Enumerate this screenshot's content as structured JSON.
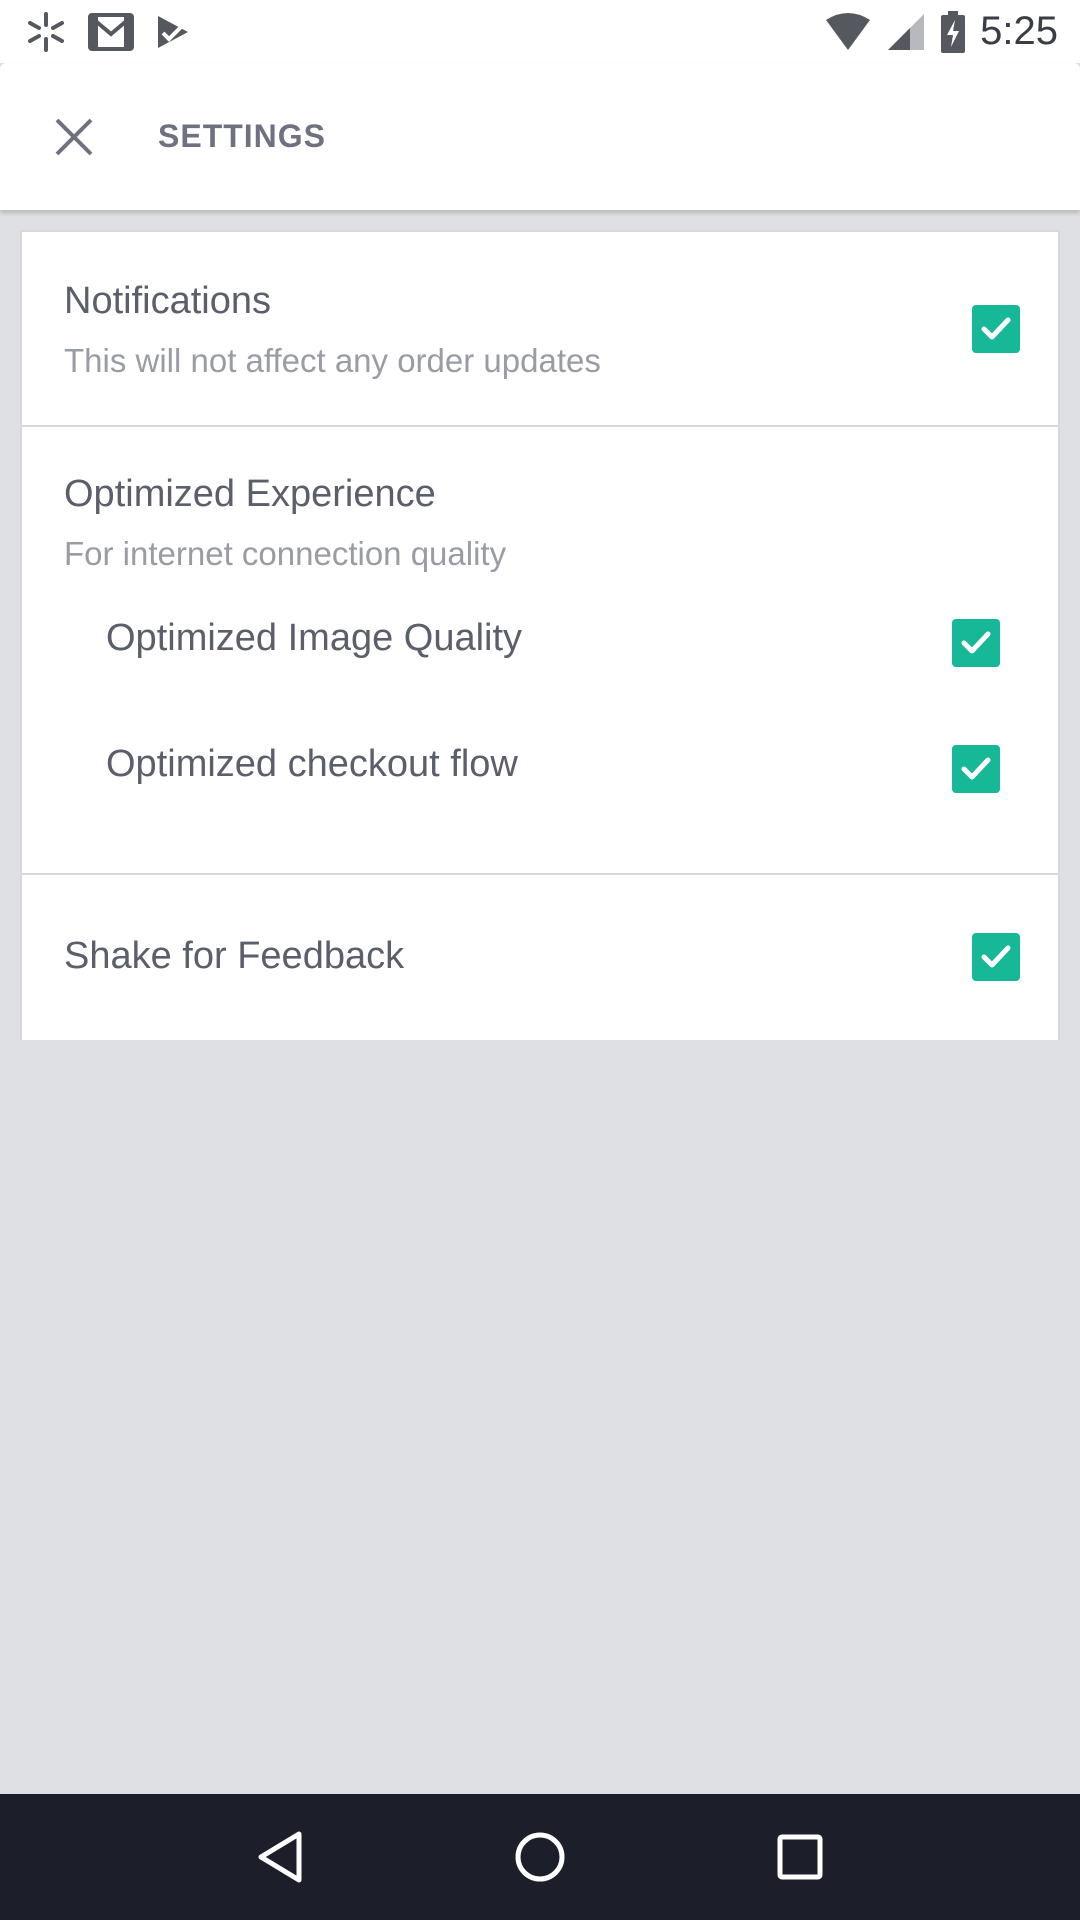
{
  "status_bar": {
    "time": "5:25",
    "left_icons": [
      "walmart-spark-icon",
      "gmail-icon",
      "play-check-icon"
    ],
    "right_icons": [
      "wifi-icon",
      "cell-signal-icon",
      "battery-charging-icon"
    ]
  },
  "app_bar": {
    "title": "SETTINGS",
    "close_icon": "close-icon"
  },
  "settings": {
    "notifications": {
      "title": "Notifications",
      "subtitle": "This will not affect any order updates",
      "checked": true
    },
    "optimized": {
      "title": "Optimized Experience",
      "subtitle": "For internet connection quality",
      "items": [
        {
          "label": "Optimized Image Quality",
          "checked": true
        },
        {
          "label": "Optimized checkout flow",
          "checked": true
        }
      ]
    },
    "shake": {
      "title": "Shake for Feedback",
      "checked": true
    }
  },
  "colors": {
    "accent": "#17b897",
    "title_text": "#5b5e6b",
    "subtitle_text": "#9a9ca5",
    "background": "#dfe0e3",
    "nav_bar": "#1c1f2a"
  },
  "nav_bar": {
    "buttons": [
      "back-icon",
      "home-icon",
      "recents-icon"
    ]
  }
}
